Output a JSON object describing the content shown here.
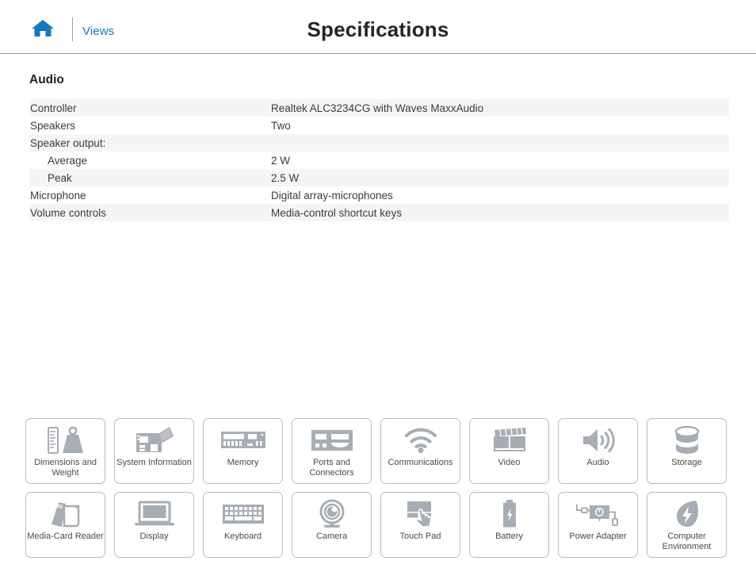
{
  "header": {
    "home_icon": "home-icon",
    "views_label": "Views",
    "title": "Specifications"
  },
  "section": {
    "heading": "Audio"
  },
  "spec_table": {
    "rows": [
      {
        "label": "Controller",
        "value": "Realtek ALC3234CG with Waves MaxxAudio",
        "indent": false,
        "shaded": true
      },
      {
        "label": "Speakers",
        "value": "Two",
        "indent": false,
        "shaded": false
      },
      {
        "label": "Speaker output:",
        "value": "",
        "indent": false,
        "shaded": true
      },
      {
        "label": "Average",
        "value": "2 W",
        "indent": true,
        "shaded": false
      },
      {
        "label": "Peak",
        "value": "2.5 W",
        "indent": true,
        "shaded": true
      },
      {
        "label": "Microphone",
        "value": "Digital array-microphones",
        "indent": false,
        "shaded": false
      },
      {
        "label": "Volume controls",
        "value": "Media-control shortcut keys",
        "indent": false,
        "shaded": true
      }
    ]
  },
  "icon_grid": {
    "row1": [
      {
        "label": "Dimensions and Weight",
        "icon": "ruler-and-weight-icon"
      },
      {
        "label": "System Information",
        "icon": "motherboard-icon"
      },
      {
        "label": "Memory",
        "icon": "memory-module-icon"
      },
      {
        "label": "Ports and Connectors",
        "icon": "ports-icon"
      },
      {
        "label": "Communications",
        "icon": "wifi-icon"
      },
      {
        "label": "Video",
        "icon": "clapperboard-icon"
      },
      {
        "label": "Audio",
        "icon": "speaker-icon"
      },
      {
        "label": "Storage",
        "icon": "drive-cylinder-icon"
      }
    ],
    "row2": [
      {
        "label": "Media-Card Reader",
        "icon": "memory-card-icon"
      },
      {
        "label": "Display",
        "icon": "laptop-screen-icon"
      },
      {
        "label": "Keyboard",
        "icon": "keyboard-icon"
      },
      {
        "label": "Camera",
        "icon": "webcam-icon"
      },
      {
        "label": "Touch Pad",
        "icon": "touchpad-hand-icon"
      },
      {
        "label": "Battery",
        "icon": "battery-icon"
      },
      {
        "label": "Power Adapter",
        "icon": "power-brick-icon"
      },
      {
        "label": "Computer Environment",
        "icon": "leaf-bolt-icon"
      }
    ]
  },
  "colors": {
    "link_blue": "#1279c0",
    "icon_gray": "#a7adb4",
    "row_shade": "#f4f5f6",
    "border_gray": "#b9bcc0",
    "text_dark": "#3b3b3b"
  }
}
